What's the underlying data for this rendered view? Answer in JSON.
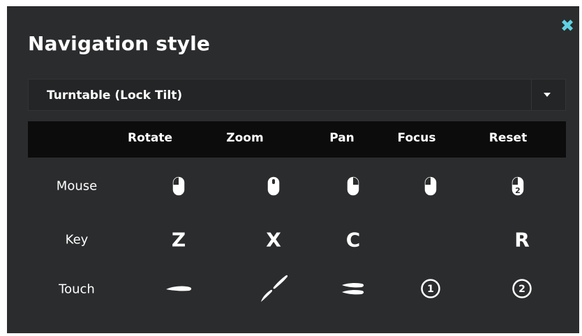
{
  "dialog": {
    "title": "Navigation style",
    "close_glyph": "✖",
    "accent_color": "#5fd3e3"
  },
  "dropdown": {
    "selected": "Turntable (Lock Tilt)",
    "caret_icon": "caret-down-icon"
  },
  "table": {
    "columns": [
      "Rotate",
      "Zoom",
      "Pan",
      "Focus",
      "Reset"
    ],
    "rows": [
      {
        "label": "Mouse",
        "cells": [
          {
            "icon": "mouse-left-button-icon"
          },
          {
            "icon": "mouse-wheel-icon"
          },
          {
            "icon": "mouse-right-button-icon"
          },
          {
            "icon": "mouse-left-button-icon"
          },
          {
            "icon": "mouse-double-click-icon",
            "badge": "2"
          }
        ]
      },
      {
        "label": "Key",
        "cells": [
          {
            "text": "Z"
          },
          {
            "text": "X"
          },
          {
            "text": "C"
          },
          {
            "text": ""
          },
          {
            "text": "R"
          }
        ]
      },
      {
        "label": "Touch",
        "cells": [
          {
            "icon": "touch-swipe-icon"
          },
          {
            "icon": "touch-pinch-icon"
          },
          {
            "icon": "touch-two-finger-swipe-icon"
          },
          {
            "icon": "touch-one-tap-icon",
            "badge": "1"
          },
          {
            "icon": "touch-two-tap-icon",
            "badge": "2"
          }
        ]
      }
    ]
  }
}
